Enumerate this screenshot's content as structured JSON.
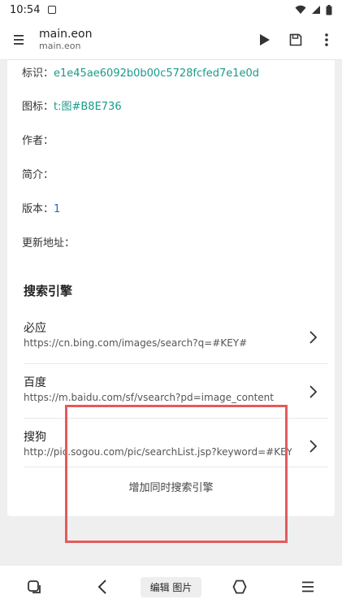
{
  "status_bar": {
    "time": "10:54"
  },
  "app_bar": {
    "title": "main.eon",
    "subtitle": "main.eon"
  },
  "info": {
    "id_label": "标识：",
    "id_value": "e1e45ae6092b0b00c5728fcfed7e1e0d",
    "icon_label": "图标：",
    "icon_value": "t:图#B8E736",
    "author_label": "作者：",
    "intro_label": "简介：",
    "version_label": "版本：",
    "version_value": "1",
    "update_label": "更新地址："
  },
  "search_section": {
    "title": "搜索引擎",
    "engines": [
      {
        "name": "必应",
        "url": "https://cn.bing.com/images/search?q=#KEY#"
      },
      {
        "name": "百度",
        "url": "https://m.baidu.com/sf/vsearch?pd=image_content"
      },
      {
        "name": "搜狗",
        "url": "http://pic.sogou.com/pic/searchList.jsp?keyword=#KEY#"
      }
    ],
    "add_label": "增加同时搜索引擎"
  },
  "nav": {
    "center_label": "编辑 图片"
  },
  "colors": {
    "teal": "#1a9a8a",
    "blue": "#2f5fd0",
    "highlight": "#e35b5b"
  }
}
